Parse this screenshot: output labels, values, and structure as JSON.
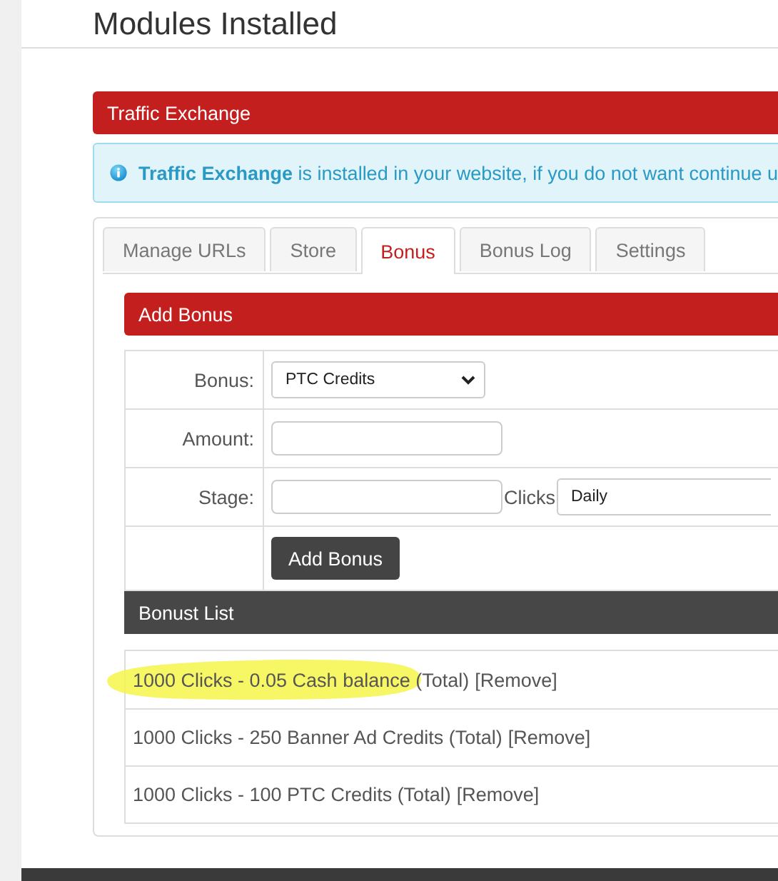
{
  "page_title": "Modules Installed",
  "panel": {
    "title": "Traffic Exchange"
  },
  "notice": {
    "text": "**Traffic Exchange** is installed in your website, if you do not want continue u"
  },
  "tabs": [
    {
      "label": "Manage URLs",
      "selected": false
    },
    {
      "label": "Store",
      "selected": false
    },
    {
      "label": "Bonus",
      "selected": true
    },
    {
      "label": "Bonus Log",
      "selected": false
    },
    {
      "label": "Settings",
      "selected": false
    }
  ],
  "add_bonus": {
    "title": "Add Bonus",
    "bonus_label": "Bonus:",
    "bonus_value": "PTC Credits",
    "amount_label": "Amount:",
    "stage_label": "Stage:",
    "stage_unit": "Clicks",
    "period_value": "Daily",
    "submit": "Add Bonus"
  },
  "bonus_list": {
    "title": "Bonust List",
    "rows": [
      {
        "text": "1000 Clicks - 0.05 Cash balance (Total)",
        "action": "[Remove]",
        "highlighted": true
      },
      {
        "text": "1000 Clicks - 250 Banner Ad Credits (Total)",
        "action": "[Remove]",
        "highlighted": false
      },
      {
        "text": "1000 Clicks - 100 PTC Credits (Total)",
        "action": "[Remove]",
        "highlighted": false
      }
    ]
  }
}
